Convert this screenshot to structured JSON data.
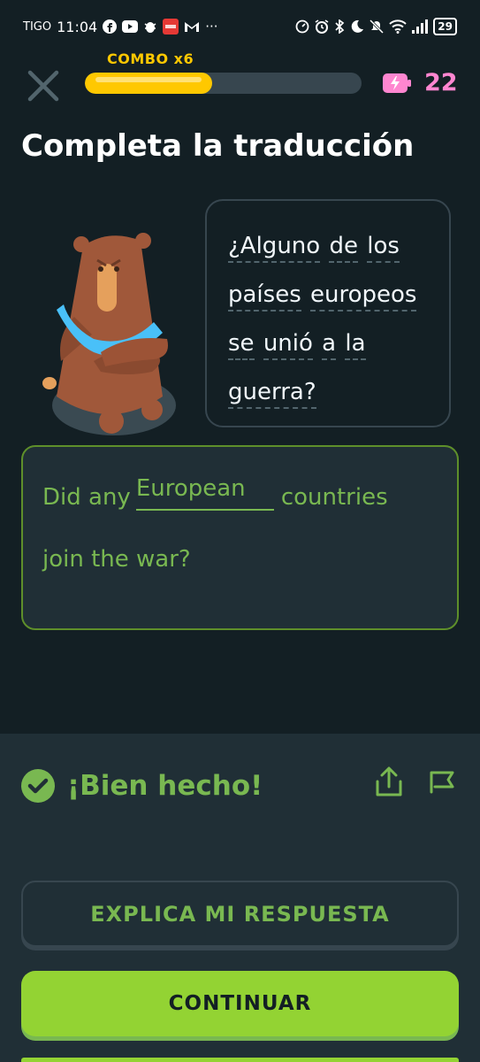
{
  "status_bar": {
    "carrier": "TIGO",
    "time": "11:04",
    "more": "···",
    "battery": "29",
    "icons_left": [
      "facebook-icon",
      "youtube-icon",
      "bug-icon",
      "news-app-icon",
      "gmail-icon"
    ],
    "icons_right": [
      "data-saver-icon",
      "alarm-icon",
      "bluetooth-icon",
      "moon-icon",
      "mute-icon",
      "wifi-icon",
      "signal-icon"
    ]
  },
  "header": {
    "combo_label": "COMBO x6",
    "progress": 0.46,
    "energy_count": "22",
    "colors": {
      "progress": "#ffc800",
      "track": "#37464f",
      "energy": "#ff86d0"
    }
  },
  "title": "Completa la traducción",
  "bubble": {
    "lines": [
      [
        "¿Alguno",
        "de",
        "los"
      ],
      [
        "países",
        "europeos"
      ],
      [
        "se",
        "unió",
        "a",
        "la"
      ],
      [
        "guerra?"
      ]
    ]
  },
  "answer": {
    "before": "Did any",
    "blank_word": "European",
    "after": "countries",
    "line2": "join the war?"
  },
  "feedback": {
    "status": "¡Bien hecho!",
    "explain_label": "EXPLICA MI RESPUESTA",
    "continue_label": "CONTINUAR",
    "colors": {
      "success": "#79b851",
      "button": "#93d333"
    }
  }
}
